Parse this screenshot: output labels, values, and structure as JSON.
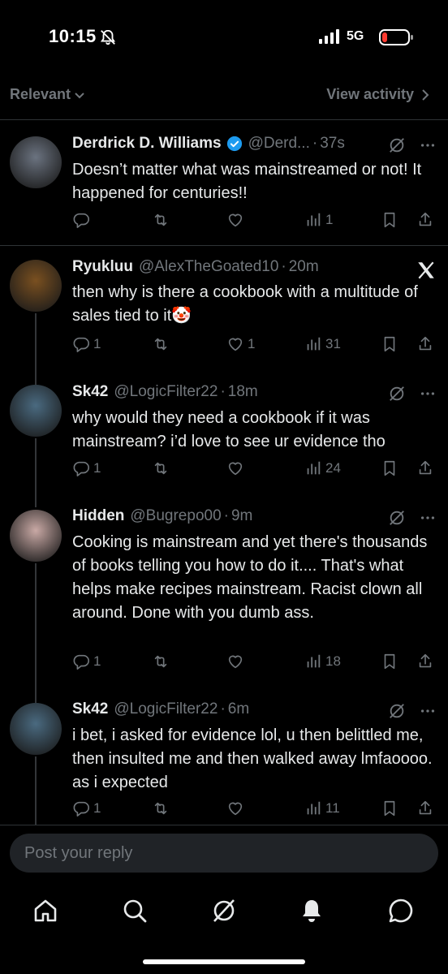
{
  "status_bar": {
    "time": "10:15",
    "network": "5G"
  },
  "filter_bar": {
    "sort_label": "Relevant",
    "activity_label": "View activity"
  },
  "posts": [
    {
      "name": "Derdrick D. Williams",
      "handle": "@Derd...",
      "time": "37s",
      "text": "Doesn’t matter what was mainstreamed or not! It happened for centuries!!",
      "replies": "",
      "likes": "",
      "views": "1",
      "verified": true
    },
    {
      "name": "Ryukluu",
      "handle": "@AlexTheGoated10",
      "time": "20m",
      "text": "then why is there a cookbook with a multitude of sales tied to it🤡",
      "replies": "1",
      "likes": "1",
      "views": "31",
      "verified": false
    },
    {
      "name": "Sk42",
      "handle": "@LogicFilter22",
      "time": "18m",
      "text": "why would they need a cookbook if it was mainstream?  i’d love to see ur evidence tho",
      "replies": "1",
      "likes": "",
      "views": "24",
      "verified": false
    },
    {
      "name": "Hidden",
      "handle": "@Bugrepo00",
      "time": "9m",
      "text": "Cooking is mainstream and yet there's thousands of books telling you how to do it.... That's what helps make recipes mainstream. Racist clown all around. Done with you dumb ass.",
      "replies": "1",
      "likes": "",
      "views": "18",
      "verified": false
    },
    {
      "name": "Sk42",
      "handle": "@LogicFilter22",
      "time": "6m",
      "text": "i bet, i asked for evidence lol,  u then belittled me, then insulted me and then walked away lmfaoooo.  as i expected",
      "replies": "1",
      "likes": "",
      "views": "11",
      "verified": false
    }
  ],
  "reply": {
    "placeholder": "Post your reply"
  },
  "colors": {
    "background": "#000000",
    "text": "#e7e9ea",
    "muted": "#71767b",
    "verified": "#1d9bf0",
    "divider": "#2f3336"
  },
  "icons": [
    "bell-muted-icon",
    "signal-icon",
    "battery-icon",
    "chevron-down-icon",
    "chevron-right-icon",
    "verified-badge-icon",
    "grok-icon",
    "more-icon",
    "x-logo-icon",
    "reply-icon",
    "repost-icon",
    "like-icon",
    "views-icon",
    "bookmark-icon",
    "share-icon",
    "home-icon",
    "search-icon",
    "grok-nav-icon",
    "notifications-icon",
    "messages-icon"
  ]
}
